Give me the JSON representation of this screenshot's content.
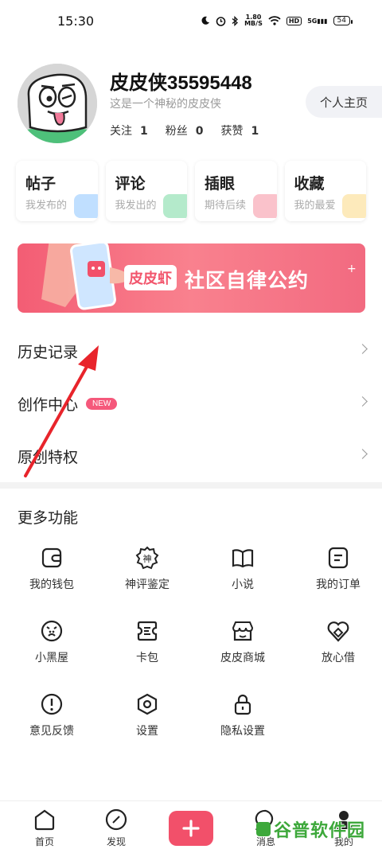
{
  "status_bar": {
    "time": "15:30",
    "net_speed_value": "1.80",
    "net_speed_unit": "MB/S",
    "hd": "HD",
    "signal": "5G",
    "battery": "54"
  },
  "profile": {
    "username": "皮皮侠35595448",
    "bio": "这是一个神秘的皮皮侠",
    "following_label": "关注",
    "following_count": "1",
    "fans_label": "粉丝",
    "fans_count": "0",
    "likes_label": "获赞",
    "likes_count": "1",
    "home_button": "个人主页"
  },
  "cards": [
    {
      "title": "帖子",
      "subtitle": "我发布的",
      "color": "#4aa4ff"
    },
    {
      "title": "评论",
      "subtitle": "我发出的",
      "color": "#27c46b"
    },
    {
      "title": "插眼",
      "subtitle": "期待后续",
      "color": "#f2506a"
    },
    {
      "title": "收藏",
      "subtitle": "我的最爱",
      "color": "#f9c43b"
    }
  ],
  "banner": {
    "badge": "皮皮虾",
    "text": "社区自律公约",
    "plus": "+"
  },
  "menu": [
    {
      "label": "历史记录"
    },
    {
      "label": "创作中心",
      "badge": "NEW"
    },
    {
      "label": "原创特权"
    }
  ],
  "more": {
    "title": "更多功能",
    "items": [
      {
        "label": "我的钱包",
        "icon": "wallet-icon"
      },
      {
        "label": "神评鉴定",
        "icon": "shen-badge-icon",
        "glyph": "神"
      },
      {
        "label": "小说",
        "icon": "book-icon"
      },
      {
        "label": "我的订单",
        "icon": "order-icon"
      },
      {
        "label": "小黑屋",
        "icon": "sad-face-icon"
      },
      {
        "label": "卡包",
        "icon": "card-pack-icon"
      },
      {
        "label": "皮皮商城",
        "icon": "shop-icon"
      },
      {
        "label": "放心借",
        "icon": "heart-loan-icon"
      },
      {
        "label": "意见反馈",
        "icon": "feedback-icon"
      },
      {
        "label": "设置",
        "icon": "settings-icon"
      },
      {
        "label": "隐私设置",
        "icon": "lock-icon"
      }
    ]
  },
  "tabbar": [
    {
      "label": "首页"
    },
    {
      "label": "发现"
    },
    {
      "label": "消息"
    },
    {
      "label": "我的"
    }
  ],
  "watermark": {
    "text": "谷普软件园"
  },
  "colors": {
    "accent": "#f2506a",
    "new_badge": "#f5587b",
    "annotation_arrow": "#e8242b"
  }
}
